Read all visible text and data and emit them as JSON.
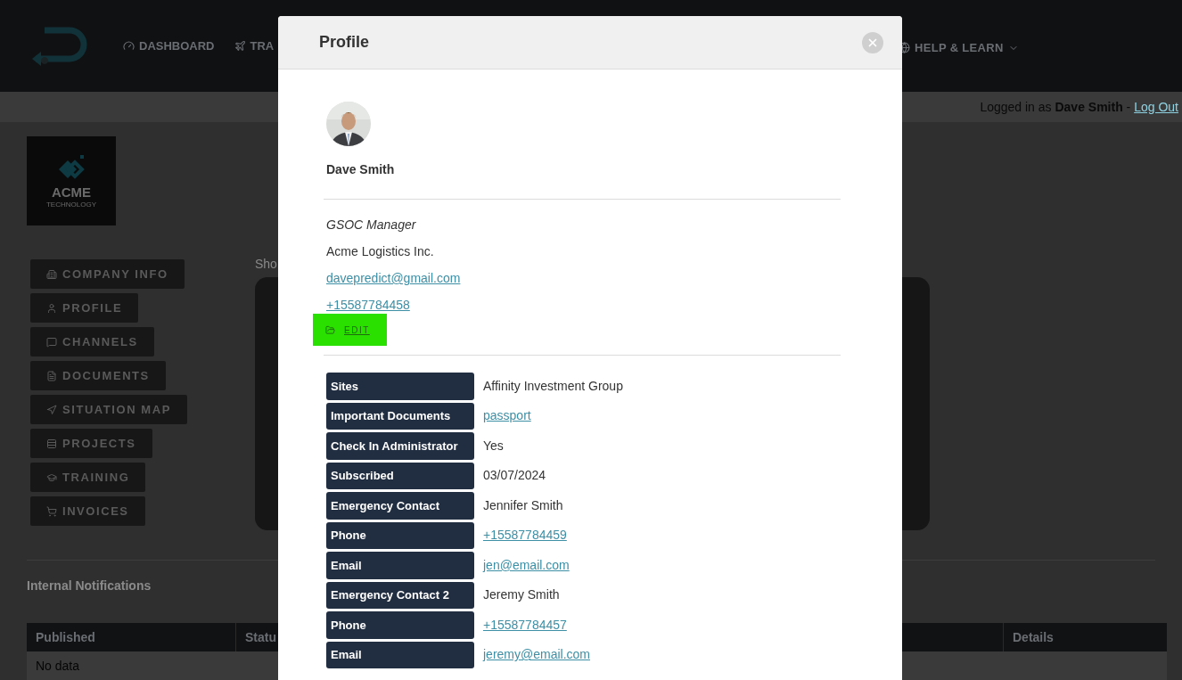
{
  "header": {
    "nav": [
      {
        "label": "DASHBOARD"
      },
      {
        "label": "TRA"
      }
    ],
    "nav_right": {
      "label": "HELP & LEARN"
    }
  },
  "login_bar": {
    "prefix": "Logged in as",
    "user": "Dave Smith",
    "separator": "-",
    "logout": "Log Out"
  },
  "company_logo": {
    "name": "ACME",
    "tagline": "TECHNOLOGY"
  },
  "sidebar": [
    {
      "label": "COMPANY INFO"
    },
    {
      "label": "PROFILE"
    },
    {
      "label": "CHANNELS"
    },
    {
      "label": "DOCUMENTS"
    },
    {
      "label": "SITUATION MAP"
    },
    {
      "label": "PROJECTS"
    },
    {
      "label": "TRAINING"
    },
    {
      "label": "INVOICES"
    }
  ],
  "content_hint": "Sho",
  "notifications": {
    "title": "Internal Notifications",
    "columns": [
      "Published",
      "Statu",
      "Details"
    ],
    "empty": "No data"
  },
  "modal": {
    "title": "Profile",
    "name": "Dave Smith",
    "role": "GSOC Manager",
    "company": "Acme Logistics Inc.",
    "email": "davepredict@gmail.com",
    "phone": "+15587784458",
    "edit": "EDIT",
    "fields": [
      {
        "label": "Sites",
        "value": "Affinity Investment Group",
        "kind": "text"
      },
      {
        "label": "Important Documents",
        "value": "passport",
        "kind": "link"
      },
      {
        "label": "Check In Administrator",
        "value": "Yes",
        "kind": "text"
      },
      {
        "label": "Subscribed",
        "value": "03/07/2024",
        "kind": "text"
      },
      {
        "label": "Emergency Contact",
        "value": "Jennifer Smith",
        "kind": "text"
      },
      {
        "label": "Phone",
        "value": "+15587784459",
        "kind": "link"
      },
      {
        "label": "Email",
        "value": "jen@email.com",
        "kind": "link"
      },
      {
        "label": "Emergency Contact 2",
        "value": "Jeremy Smith",
        "kind": "text"
      },
      {
        "label": "Phone",
        "value": "+15587784457",
        "kind": "link"
      },
      {
        "label": "Email",
        "value": "jeremy@email.com",
        "kind": "link"
      }
    ]
  }
}
